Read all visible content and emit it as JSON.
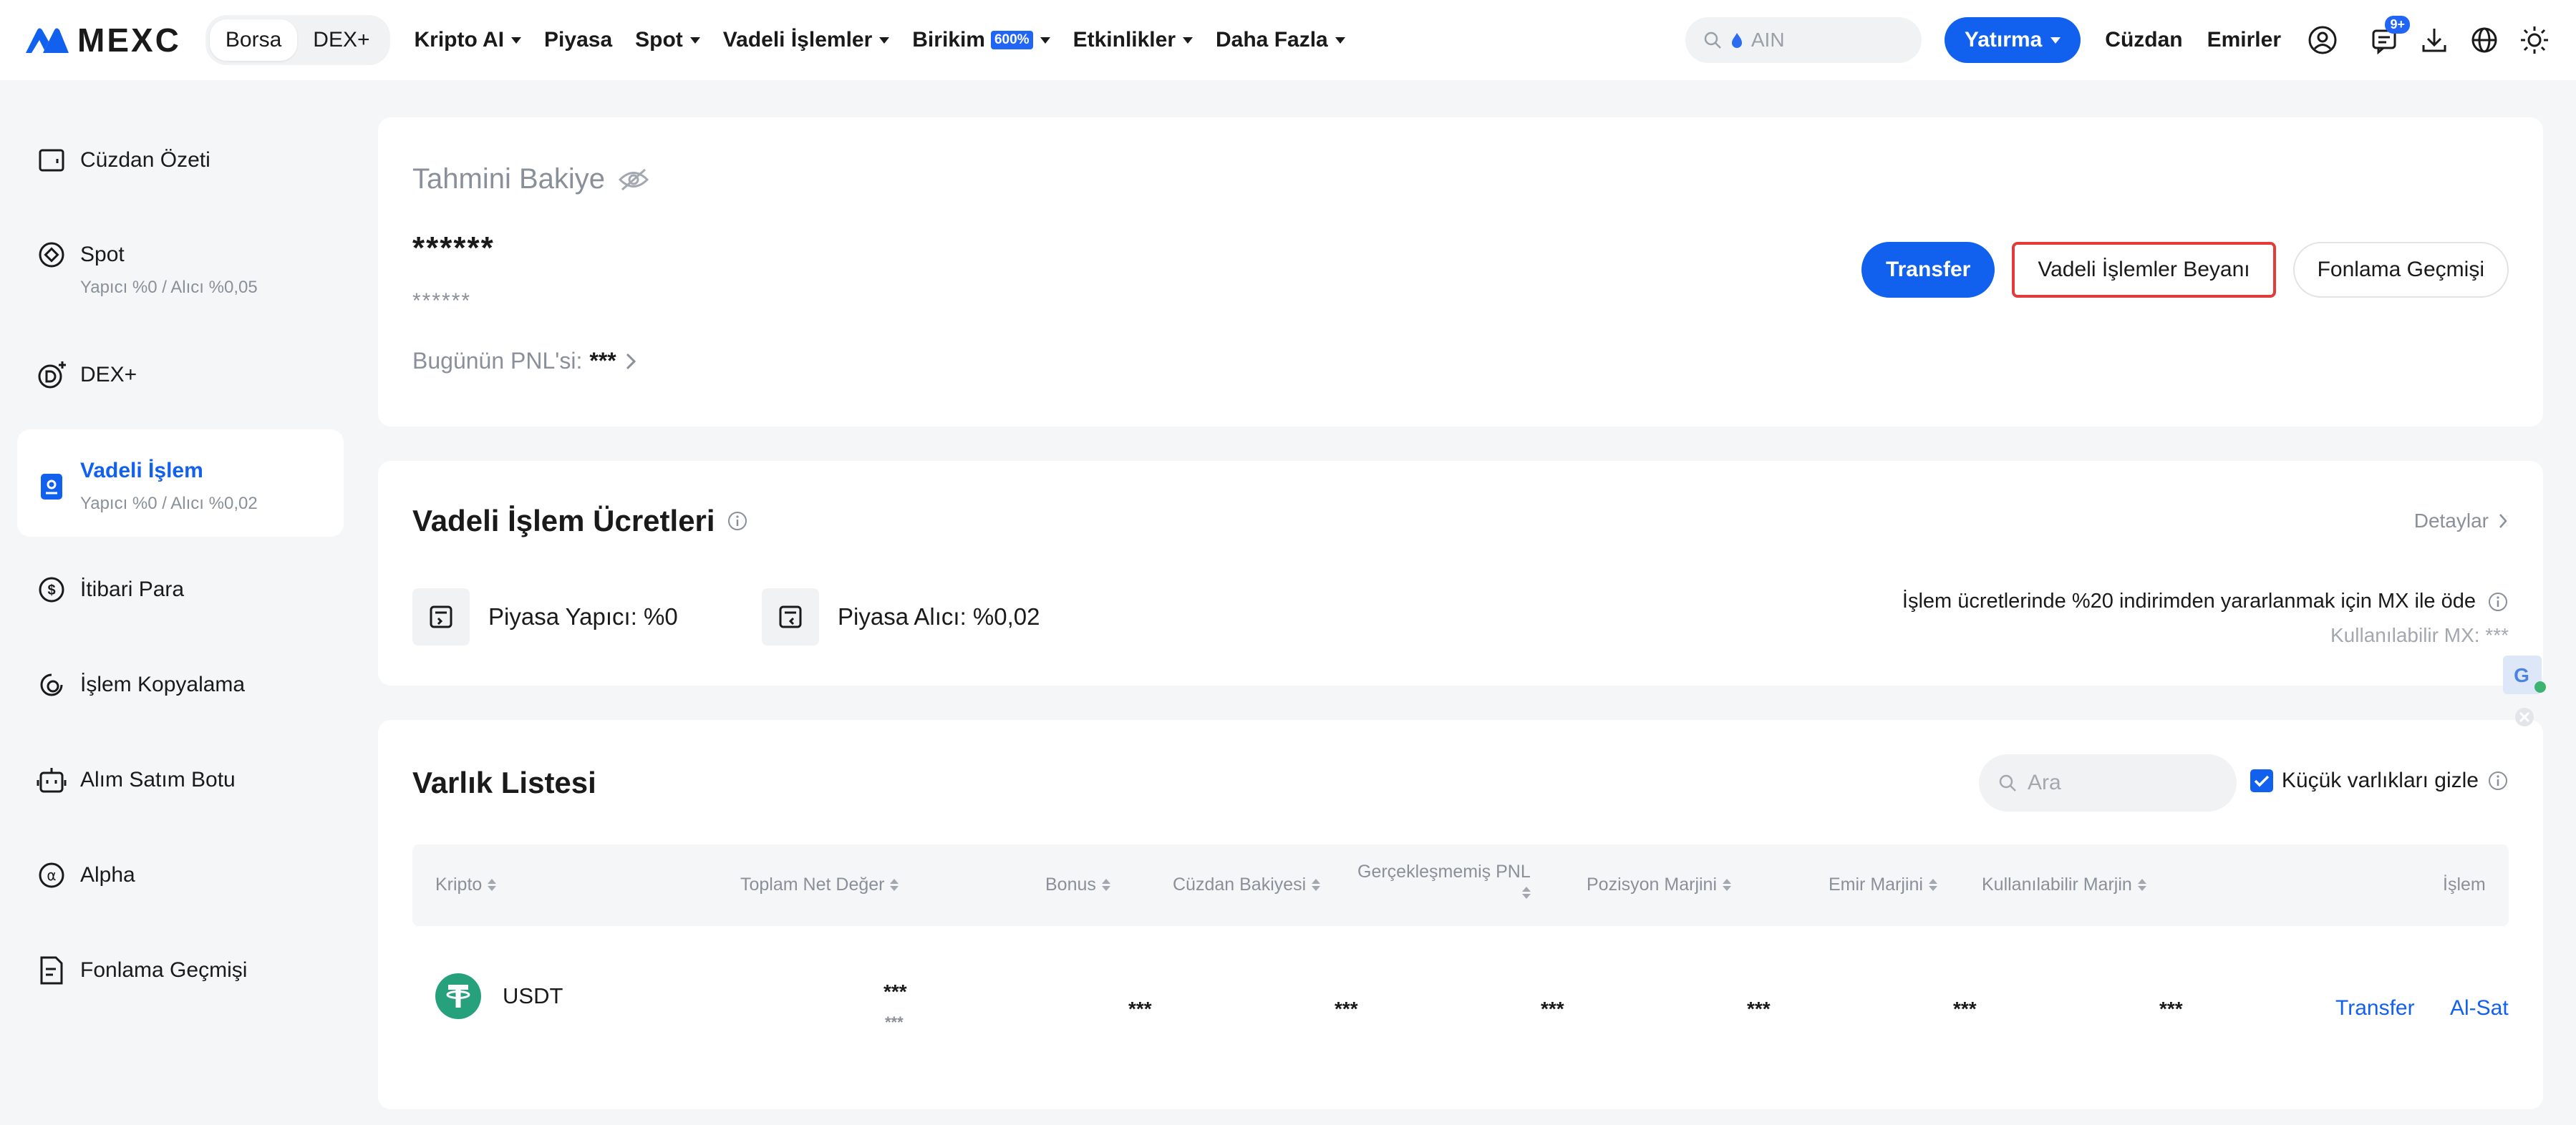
{
  "nav": {
    "logo_text": "MEXC",
    "seg": [
      "Borsa",
      "DEX+"
    ],
    "items": [
      {
        "label": "Kripto AI",
        "caret": true
      },
      {
        "label": "Piyasa",
        "caret": false
      },
      {
        "label": "Spot",
        "caret": true
      },
      {
        "label": "Vadeli İşlemler",
        "caret": true
      },
      {
        "label": "Birikim",
        "caret": true,
        "badge": "600%"
      },
      {
        "label": "Etkinlikler",
        "caret": true
      },
      {
        "label": "Daha Fazla",
        "caret": true
      }
    ],
    "search_placeholder": "AIN",
    "deposit_label": "Yatırma",
    "wallet_label": "Cüzdan",
    "orders_label": "Emirler",
    "notif_count": "9+",
    "accent": "#1160ee"
  },
  "sidebar": {
    "items": [
      {
        "label": "Cüzdan Özeti",
        "sub": "",
        "icon": "wallet-icon"
      },
      {
        "label": "Spot",
        "sub": "Yapıcı %0 / Alıcı %0,05",
        "icon": "spot-icon"
      },
      {
        "label": "DEX+",
        "sub": "",
        "icon": "dex-icon"
      },
      {
        "label": "Vadeli İşlem",
        "sub": "Yapıcı %0 / Alıcı %0,02",
        "icon": "futures-icon",
        "active": true
      },
      {
        "label": "İtibari Para",
        "sub": "",
        "icon": "dollar-icon"
      },
      {
        "label": "İşlem Kopyalama",
        "sub": "",
        "icon": "copy-trade-icon"
      },
      {
        "label": "Alım Satım Botu",
        "sub": "",
        "icon": "bot-icon"
      },
      {
        "label": "Alpha",
        "sub": "",
        "icon": "alpha-icon"
      },
      {
        "label": "Fonlama Geçmişi",
        "sub": "",
        "icon": "history-icon"
      }
    ]
  },
  "balance": {
    "title": "Tahmini Bakiye",
    "main": "******",
    "sub": "******",
    "pnl_label": "Bugünün PNL'si:",
    "pnl_value": "***",
    "buttons": {
      "transfer": "Transfer",
      "statement": "Vadeli İşlemler Beyanı",
      "funding": "Fonlama Geçmişi"
    }
  },
  "fees": {
    "title": "Vadeli İşlem Ücretleri",
    "details": "Detaylar",
    "maker": "Piyasa Yapıcı: %0",
    "taker": "Piyasa Alıcı: %0,02",
    "mx_line": "İşlem ücretlerinde %20 indirimden yararlanmak için MX ile öde",
    "mx_available": "Kullanılabilir MX: ***"
  },
  "assets": {
    "title": "Varlık Listesi",
    "search_placeholder": "Ara",
    "hide_small": "Küçük varlıkları gizle",
    "columns": [
      "Kripto",
      "Toplam Net Değer",
      "Bonus",
      "Cüzdan Bakiyesi",
      "Gerçekleşmemiş PNL",
      "Pozisyon Marjini",
      "Emir Marjini",
      "Kullanılabilir Marjin",
      "İşlem"
    ],
    "rows": [
      {
        "coin": "USDT",
        "total": "***",
        "total_sub": "***",
        "bonus": "***",
        "wallet": "***",
        "upnl": "***",
        "pos_margin": "***",
        "order_margin": "***",
        "avail_margin": "***",
        "actions": [
          "Transfer",
          "Al-Sat"
        ]
      }
    ]
  }
}
